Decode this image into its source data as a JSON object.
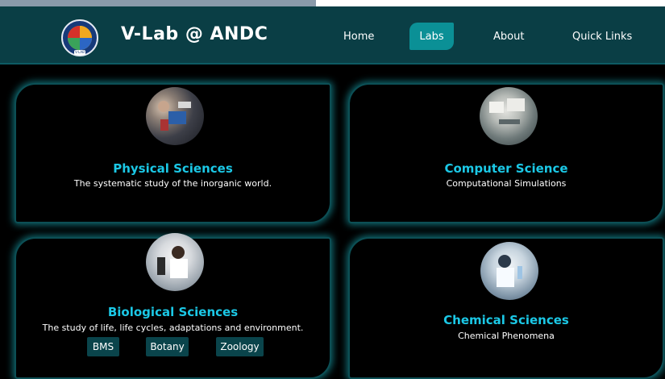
{
  "header": {
    "site_title": "V-Lab @ ANDC",
    "logo_label": "V-LAB",
    "nav": {
      "home": "Home",
      "labs": "Labs",
      "about": "About",
      "quick_links": "Quick Links"
    },
    "active_nav": "Labs"
  },
  "labs": [
    {
      "title": "Physical Sciences",
      "description": "The systematic study of the inorganic world.",
      "image": "lab-equipment-photo"
    },
    {
      "title": "Computer Science",
      "description": "Computational Simulations",
      "image": "computers-photo"
    },
    {
      "title": "Biological Sciences",
      "description": "The study of life, life cycles, adaptations and environment.",
      "image": "microscope-photo",
      "subjects": [
        "BMS",
        "Botany",
        "Zoology"
      ]
    },
    {
      "title": "Chemical Sciences",
      "description": "Chemical Phenomena",
      "image": "chemist-photo"
    }
  ],
  "colors": {
    "navbar": "#0a3e45",
    "active_tab": "#0b9096",
    "card_title": "#1bc8e6",
    "card_glow": "#148c96",
    "subject_button": "#0a444b"
  }
}
